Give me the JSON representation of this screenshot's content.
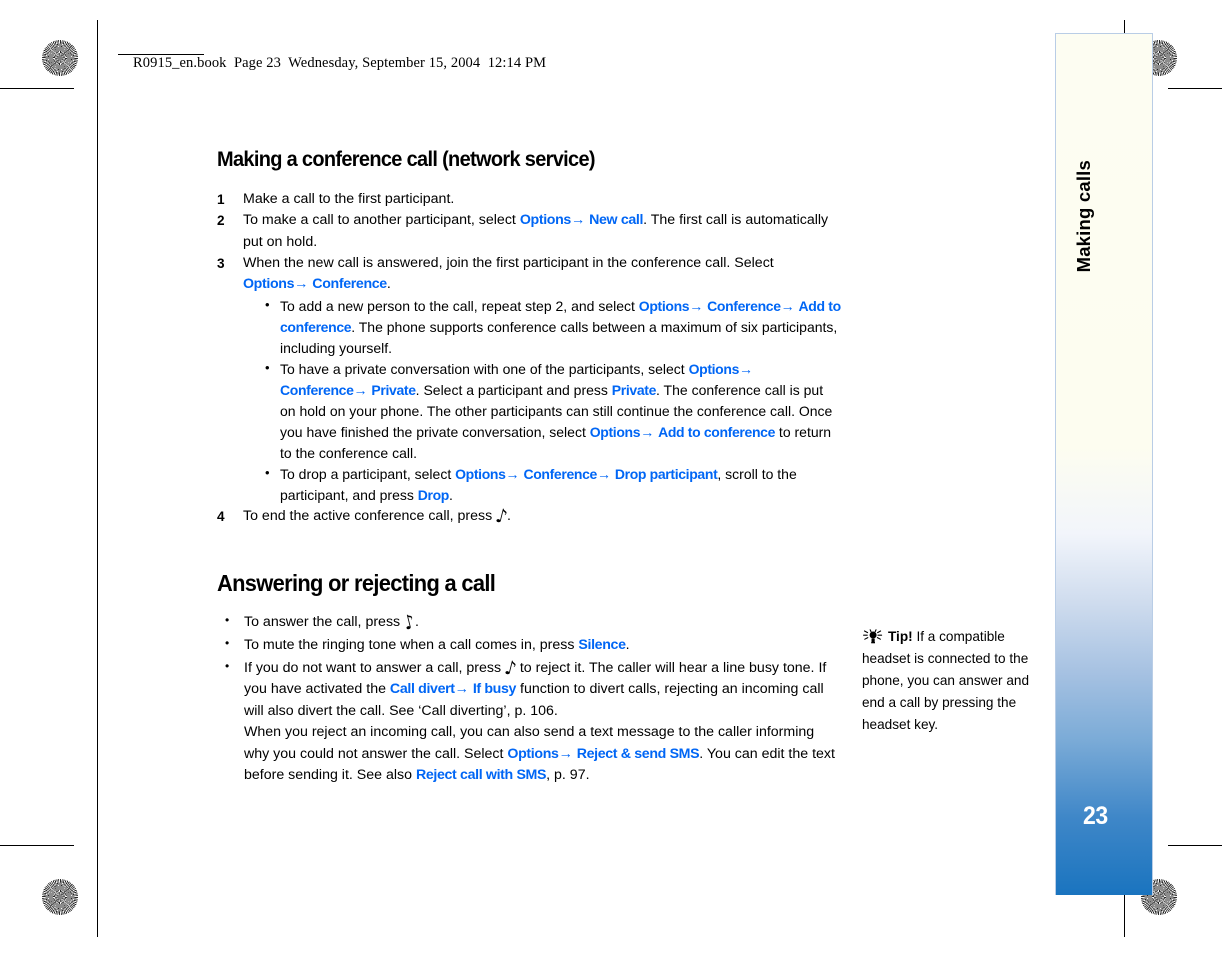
{
  "document": {
    "running_header": "R0915_en.book  Page 23  Wednesday, September 15, 2004  12:14 PM",
    "page_number": "23",
    "tab_label": "Making calls"
  },
  "section1": {
    "heading": "Making a conference call (network service)",
    "steps": [
      {
        "num": "1",
        "text_1": "Make a call to the first participant."
      },
      {
        "num": "2",
        "text_1": "To make a call to another participant, select ",
        "link_1": "Options",
        "arrow_1": "→",
        "link_2": "New call",
        "text_2": ". The first call is automatically put on hold."
      },
      {
        "num": "3",
        "text_1": "When the new call is answered, join the first participant in the conference call. Select ",
        "link_1": "Options",
        "arrow_1": "→",
        "link_2": "Conference",
        "text_2": "."
      },
      {
        "num": "4",
        "text_1": "To end the active conference call, press ",
        "glyph": "♪",
        "text_2": "."
      }
    ],
    "sub_bullets": [
      {
        "text_1": "To add a new person to the call, repeat step 2, and select ",
        "link_1": "Options",
        "arrow_1": "→",
        "link_2": "Conference",
        "arrow_2": "→",
        "link_3": "Add to conference",
        "text_2": ". The phone supports conference calls between a maximum of six participants, including yourself."
      },
      {
        "text_1": "To have a private conversation with one of the participants, select ",
        "link_1": "Options",
        "arrow_1": "→",
        "link_2": "Conference",
        "arrow_2": "→",
        "link_3": "Private",
        "text_2": ". Select a participant and press ",
        "link_4": "Private",
        "text_3": ". The conference call is put on hold on your phone. The other participants can still continue the conference call. Once you have finished the private conversation, select ",
        "link_5": "Options",
        "arrow_3": "→",
        "link_6": "Add to conference",
        "text_4": " to return to the conference call."
      },
      {
        "text_1": "To drop a participant, select ",
        "link_1": "Options",
        "arrow_1": "→",
        "link_2": "Conference",
        "arrow_2": "→",
        "link_3": "Drop participant",
        "text_2": ", scroll to the participant, and press ",
        "link_4": "Drop",
        "text_3": "."
      }
    ]
  },
  "section2": {
    "heading": "Answering or rejecting a call",
    "bullets": [
      {
        "text_1": "To answer the call, press ",
        "glyph": "♪",
        "text_2": "."
      },
      {
        "text_1": "To mute the ringing tone when a call comes in, press ",
        "link_1": "Silence",
        "text_2": "."
      },
      {
        "text_1": "If you do not want to answer a call, press ",
        "glyph": "♪",
        "text_2": " to reject it. The caller will hear a line busy tone. If you have activated the ",
        "link_1": "Call divert",
        "arrow_1": "→",
        "link_2": "If busy",
        "text_3": " function to divert calls, rejecting an incoming call will also divert the call. See ‘Call diverting’, p. 106.",
        "text_4": "When you reject an incoming call, you can also send a text message to the caller informing why you could not answer the call. Select  ",
        "link_3": "Options",
        "arrow_2": "→",
        "link_4": "Reject & send SMS",
        "text_5": ". You can edit the text before sending it. See also ",
        "link_5": "Reject call with SMS",
        "text_6": ", p. 97."
      }
    ]
  },
  "tip": {
    "label": "Tip!",
    "text": " If a compatible headset is connected to the phone, you can answer and end a call by pressing the headset key."
  },
  "colors": {
    "link": "#0066f5",
    "tab_blue": "#1a74bf",
    "tab_cream": "#fdfdf2",
    "tab_border": "#b9cde6"
  }
}
